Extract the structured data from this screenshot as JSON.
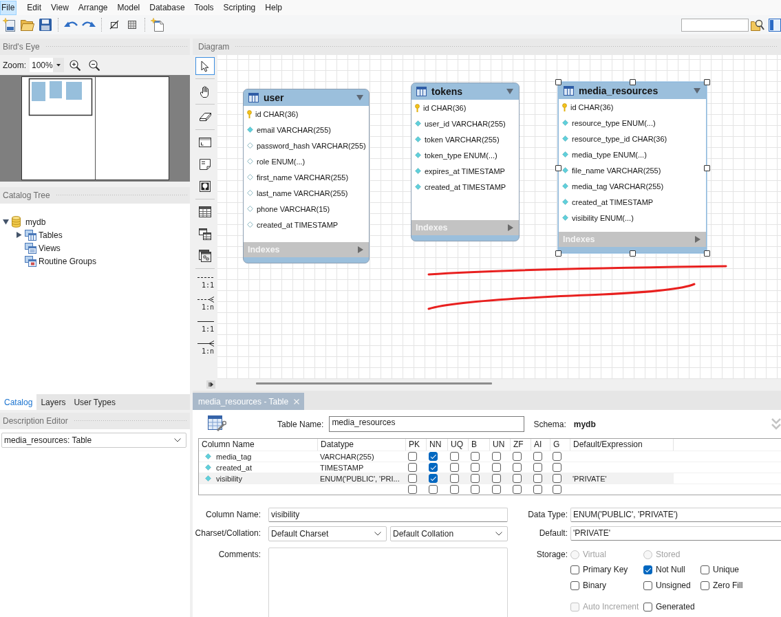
{
  "menu": [
    {
      "label": "File",
      "selected": true
    },
    {
      "label": "Edit",
      "selected": false
    },
    {
      "label": "View",
      "selected": false
    },
    {
      "label": "Arrange",
      "selected": false
    },
    {
      "label": "Model",
      "selected": false
    },
    {
      "label": "Database",
      "selected": false
    },
    {
      "label": "Tools",
      "selected": false
    },
    {
      "label": "Scripting",
      "selected": false
    },
    {
      "label": "Help",
      "selected": false
    }
  ],
  "birds_eye": {
    "title": "Bird's Eye",
    "zoom_label": "Zoom:",
    "zoom": "100%"
  },
  "catalog_tree": {
    "title": "Catalog Tree",
    "nodes": [
      {
        "label": "mydb",
        "kind": "schema",
        "expanded": true,
        "children": [
          {
            "label": "Tables",
            "kind": "tables",
            "expanded": false
          },
          {
            "label": "Views",
            "kind": "views"
          },
          {
            "label": "Routine Groups",
            "kind": "routines"
          }
        ]
      }
    ]
  },
  "left_tabs": [
    {
      "label": "Catalog",
      "selected": true
    },
    {
      "label": "Layers",
      "selected": false
    },
    {
      "label": "User Types",
      "selected": false
    }
  ],
  "description_editor": {
    "title": "Description Editor",
    "object": "media_resources: Table"
  },
  "diagram": {
    "title": "Diagram",
    "tools": [
      {
        "kind": "pointer",
        "selected": true
      },
      {
        "kind": "hand",
        "selected": false
      },
      {
        "kind": "eraser",
        "selected": false
      },
      {
        "kind": "layer",
        "selected": false
      },
      {
        "kind": "note",
        "selected": false
      },
      {
        "kind": "image",
        "selected": false
      },
      {
        "kind": "table",
        "selected": false
      },
      {
        "kind": "view",
        "selected": false
      },
      {
        "kind": "routine_group",
        "selected": false
      },
      {
        "kind": "relationship",
        "label": "1:1",
        "dashed": true,
        "many": false,
        "selected": false
      },
      {
        "kind": "relationship",
        "label": "1:n",
        "dashed": true,
        "many": true,
        "selected": false
      },
      {
        "kind": "relationship",
        "label": "1:1",
        "dashed": false,
        "many": false,
        "selected": false
      },
      {
        "kind": "relationship",
        "label": "1:n",
        "dashed": false,
        "many": true,
        "selected": false
      }
    ],
    "tables": [
      {
        "name": "user",
        "selected": false,
        "columns": [
          {
            "kind": "primary",
            "text": "id CHAR(36)"
          },
          {
            "kind": "not_null",
            "text": "email VARCHAR(255)"
          },
          {
            "kind": "nullable",
            "text": "password_hash VARCHAR(255)"
          },
          {
            "kind": "nullable",
            "text": "role ENUM(...)"
          },
          {
            "kind": "nullable",
            "text": "first_name VARCHAR(255)"
          },
          {
            "kind": "nullable",
            "text": "last_name VARCHAR(255)"
          },
          {
            "kind": "nullable",
            "text": "phone VARCHAR(15)"
          },
          {
            "kind": "nullable",
            "text": "created_at TIMESTAMP"
          }
        ],
        "indexes": "Indexes"
      },
      {
        "name": "tokens",
        "selected": false,
        "columns": [
          {
            "kind": "primary",
            "text": "id CHAR(36)"
          },
          {
            "kind": "not_null",
            "text": "user_id VARCHAR(255)"
          },
          {
            "kind": "not_null",
            "text": "token VARCHAR(255)"
          },
          {
            "kind": "not_null",
            "text": "token_type ENUM(...)"
          },
          {
            "kind": "not_null",
            "text": "expires_at TIMESTAMP"
          },
          {
            "kind": "not_null",
            "text": "created_at TIMESTAMP"
          }
        ],
        "indexes": "Indexes"
      },
      {
        "name": "media_resources",
        "selected": true,
        "columns": [
          {
            "kind": "primary",
            "text": "id CHAR(36)"
          },
          {
            "kind": "not_null",
            "text": "resource_type ENUM(...)"
          },
          {
            "kind": "not_null",
            "text": "resource_type_id CHAR(36)"
          },
          {
            "kind": "not_null",
            "text": "media_type ENUM(...)"
          },
          {
            "kind": "not_null",
            "text": "file_name VARCHAR(255)"
          },
          {
            "kind": "not_null",
            "text": "media_tag VARCHAR(255)"
          },
          {
            "kind": "not_null",
            "text": "created_at TIMESTAMP"
          },
          {
            "kind": "not_null",
            "text": "visibility ENUM(...)"
          }
        ],
        "indexes": "Indexes"
      }
    ]
  },
  "editor": {
    "tab": {
      "label": "media_resources - Table",
      "selected": true
    },
    "table_name_label": "Table Name:",
    "table_name": "media_resources",
    "schema_label": "Schema:",
    "schema": "mydb",
    "grid": {
      "columns": [
        "Column Name",
        "Datatype",
        "PK",
        "NN",
        "UQ",
        "B",
        "UN",
        "ZF",
        "AI",
        "G",
        "Default/Expression"
      ],
      "rows": [
        {
          "kind": "column",
          "name": "media_tag",
          "datatype": "VARCHAR(255)",
          "checks": [
            false,
            true,
            false,
            false,
            false,
            false,
            false,
            false
          ],
          "selected": false
        },
        {
          "kind": "column",
          "name": "created_at",
          "datatype": "TIMESTAMP",
          "checks": [
            false,
            true,
            false,
            false,
            false,
            false,
            false,
            false
          ],
          "selected": false
        },
        {
          "kind": "column",
          "name": "visibility",
          "datatype": "ENUM('PUBLIC', 'PRI...",
          "checks": [
            false,
            true,
            false,
            false,
            false,
            false,
            false,
            false
          ],
          "default": "'PRIVATE'",
          "selected": true
        },
        {
          "kind": "new",
          "checks": [
            false,
            false,
            false,
            false,
            false,
            false,
            false,
            false
          ],
          "selected": false
        }
      ]
    },
    "column_details": {
      "column_name_label": "Column Name:",
      "column_name": "visibility",
      "charset_label": "Charset/Collation:",
      "charset": "Default Charset",
      "collation": "Default Collation",
      "comments_label": "Comments:",
      "data_type_label": "Data Type:",
      "data_type": "ENUM('PUBLIC', 'PRIVATE')",
      "default_label": "Default:",
      "default": "'PRIVATE'",
      "storage_label": "Storage:",
      "storage": [
        {
          "label": "Virtual",
          "selected": false,
          "disabled": true
        },
        {
          "label": "Stored",
          "selected": false,
          "disabled": true
        }
      ],
      "options": [
        {
          "label": "Primary Key",
          "checked": false,
          "disabled": false
        },
        {
          "label": "Not Null",
          "checked": true,
          "disabled": false
        },
        {
          "label": "Unique",
          "checked": false,
          "disabled": false
        },
        {
          "label": "Binary",
          "checked": false,
          "disabled": false
        },
        {
          "label": "Unsigned",
          "checked": false,
          "disabled": false
        },
        {
          "label": "Zero Fill",
          "checked": false,
          "disabled": false
        },
        {
          "label": "Auto Increment",
          "checked": false,
          "disabled": true
        },
        {
          "label": "Generated",
          "checked": false,
          "disabled": false
        }
      ]
    }
  }
}
